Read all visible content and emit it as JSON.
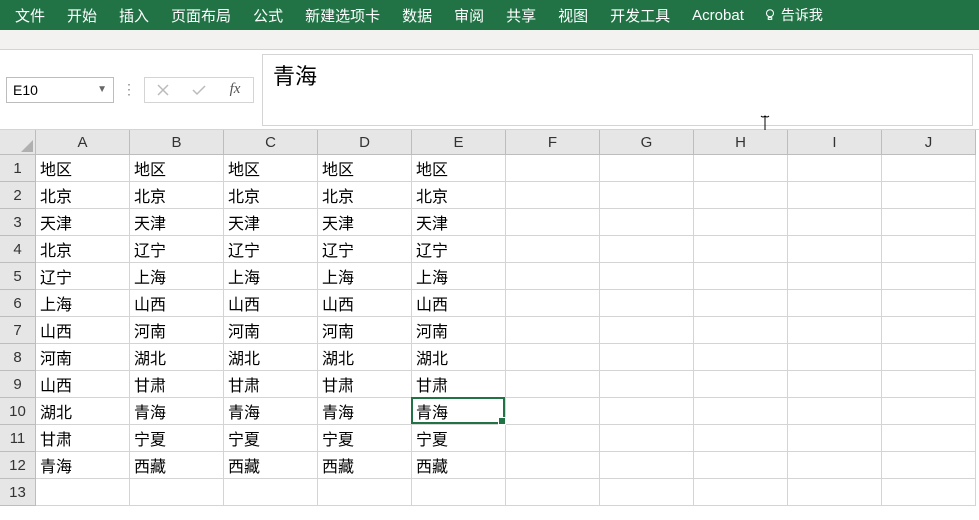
{
  "ribbon": {
    "file": "文件",
    "home": "开始",
    "insert": "插入",
    "page_layout": "页面布局",
    "formulas": "公式",
    "new_tab": "新建选项卡",
    "data": "数据",
    "review": "审阅",
    "share": "共享",
    "view": "视图",
    "developer": "开发工具",
    "acrobat": "Acrobat",
    "tell_me": "告诉我"
  },
  "formula_bar": {
    "name_box": "E10",
    "formula_value": "青海"
  },
  "columns": [
    "A",
    "B",
    "C",
    "D",
    "E",
    "F",
    "G",
    "H",
    "I",
    "J"
  ],
  "row_numbers": [
    "1",
    "2",
    "3",
    "4",
    "5",
    "6",
    "7",
    "8",
    "9",
    "10",
    "11",
    "12",
    "13"
  ],
  "grid": {
    "rows": [
      {
        "cells": [
          "地区",
          "地区",
          "地区",
          "地区",
          "地区",
          "",
          "",
          "",
          "",
          ""
        ]
      },
      {
        "cells": [
          "北京",
          "北京",
          "北京",
          "北京",
          "北京",
          "",
          "",
          "",
          "",
          ""
        ]
      },
      {
        "cells": [
          "天津",
          "天津",
          "天津",
          "天津",
          "天津",
          "",
          "",
          "",
          "",
          ""
        ]
      },
      {
        "cells": [
          "北京",
          "辽宁",
          "辽宁",
          "辽宁",
          "辽宁",
          "",
          "",
          "",
          "",
          ""
        ]
      },
      {
        "cells": [
          "辽宁",
          "上海",
          "上海",
          "上海",
          "上海",
          "",
          "",
          "",
          "",
          ""
        ]
      },
      {
        "cells": [
          "上海",
          "山西",
          "山西",
          "山西",
          "山西",
          "",
          "",
          "",
          "",
          ""
        ]
      },
      {
        "cells": [
          "山西",
          "河南",
          "河南",
          "河南",
          "河南",
          "",
          "",
          "",
          "",
          ""
        ]
      },
      {
        "cells": [
          "河南",
          "湖北",
          "湖北",
          "湖北",
          "湖北",
          "",
          "",
          "",
          "",
          ""
        ]
      },
      {
        "cells": [
          "山西",
          "甘肃",
          "甘肃",
          "甘肃",
          "甘肃",
          "",
          "",
          "",
          "",
          ""
        ]
      },
      {
        "cells": [
          "湖北",
          "青海",
          "青海",
          "青海",
          "青海",
          "",
          "",
          "",
          "",
          ""
        ]
      },
      {
        "cells": [
          "甘肃",
          "宁夏",
          "宁夏",
          "宁夏",
          "宁夏",
          "",
          "",
          "",
          "",
          ""
        ]
      },
      {
        "cells": [
          "青海",
          "西藏",
          "西藏",
          "西藏",
          "西藏",
          "",
          "",
          "",
          "",
          ""
        ]
      },
      {
        "cells": [
          "",
          "",
          "",
          "",
          "",
          "",
          "",
          "",
          "",
          ""
        ]
      }
    ]
  },
  "active_cell": {
    "row": 9,
    "col": 4
  }
}
